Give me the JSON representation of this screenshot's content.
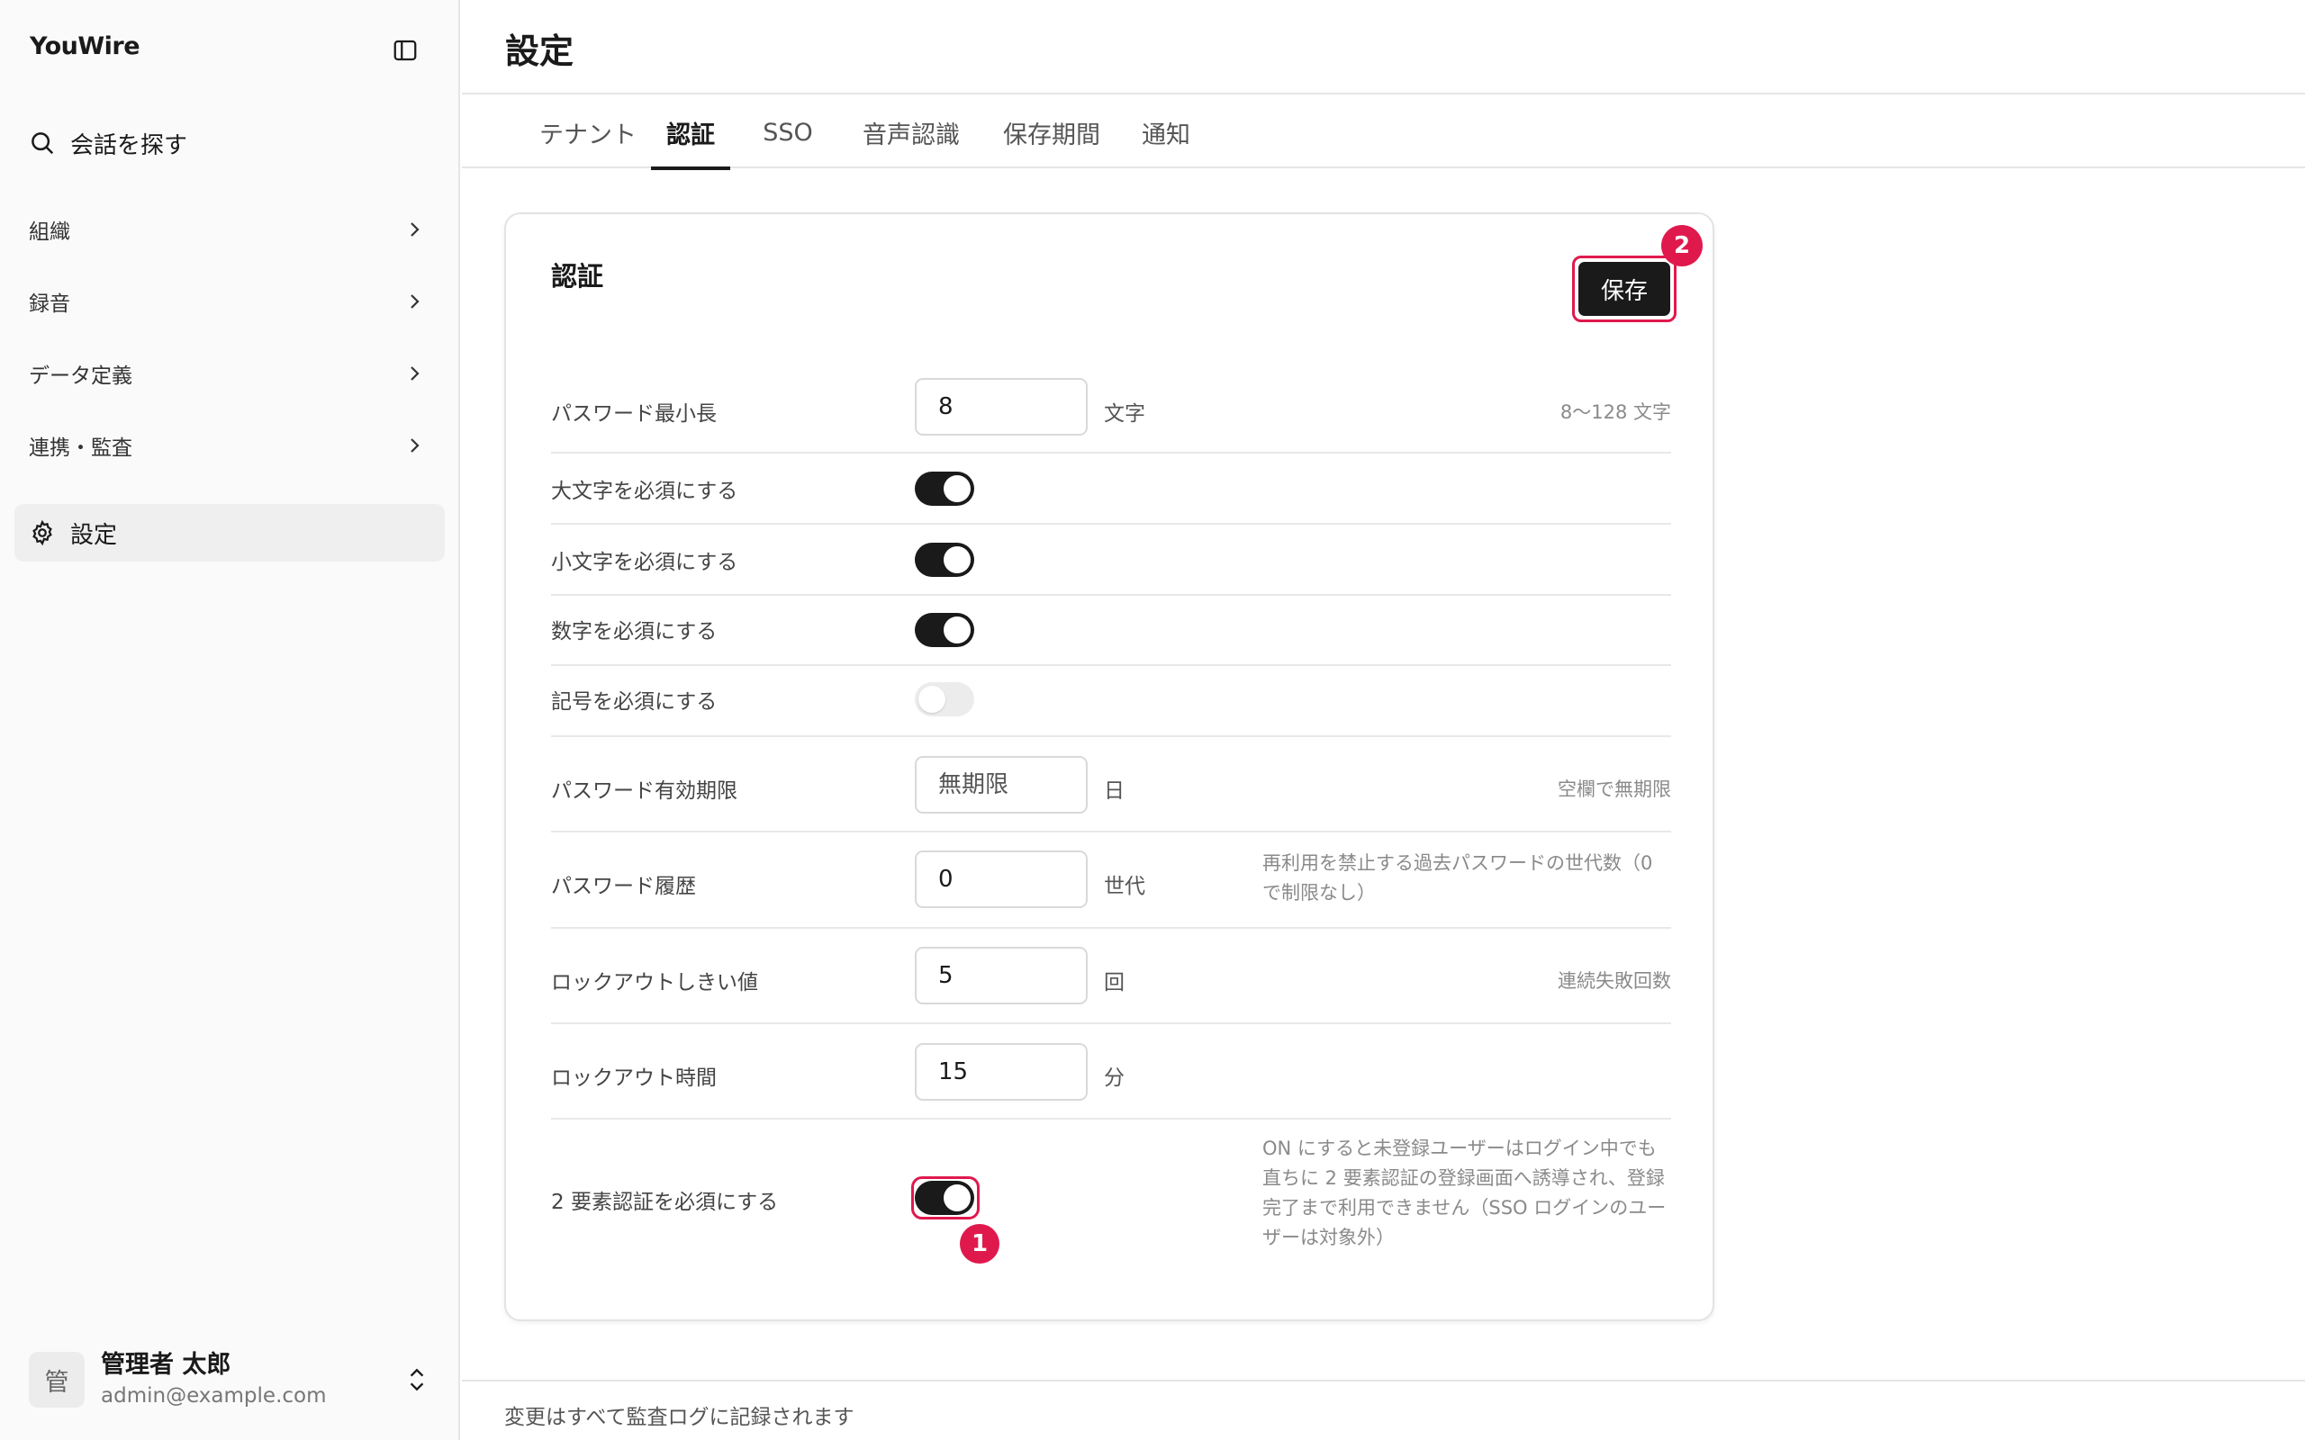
{
  "app": {
    "name": "YouWire"
  },
  "sidebar": {
    "search_label": "会話を探す",
    "items": [
      {
        "label": "組織"
      },
      {
        "label": "録音"
      },
      {
        "label": "データ定義"
      },
      {
        "label": "連携・監査"
      }
    ],
    "active_item": {
      "label": "設定"
    },
    "user": {
      "avatar_text": "管",
      "name": "管理者 太郎",
      "email": "admin@example.com"
    }
  },
  "header": {
    "title": "設定"
  },
  "tabs": [
    {
      "label": "テナント",
      "active": false
    },
    {
      "label": "認証",
      "active": true
    },
    {
      "label": "SSO",
      "active": false
    },
    {
      "label": "音声認識",
      "active": false
    },
    {
      "label": "保存期間",
      "active": false
    },
    {
      "label": "通知",
      "active": false
    }
  ],
  "card": {
    "title": "認証",
    "save_label": "保存",
    "markers": {
      "save": "2",
      "two_factor": "1"
    },
    "rows": {
      "min_length": {
        "label": "パスワード最小長",
        "value": "8",
        "unit": "文字",
        "hint": "8〜128 文字"
      },
      "uppercase": {
        "label": "大文字を必須にする",
        "on": true
      },
      "lowercase": {
        "label": "小文字を必須にする",
        "on": true
      },
      "digits": {
        "label": "数字を必須にする",
        "on": true
      },
      "symbols": {
        "label": "記号を必須にする",
        "on": false
      },
      "expiry": {
        "label": "パスワード有効期限",
        "value": "",
        "placeholder": "無期限",
        "unit": "日",
        "hint": "空欄で無期限"
      },
      "history": {
        "label": "パスワード履歴",
        "value": "0",
        "unit": "世代",
        "hint": "再利用を禁止する過去パスワードの世代数（0 で制限なし）"
      },
      "lockout_threshold": {
        "label": "ロックアウトしきい値",
        "value": "5",
        "unit": "回",
        "hint": "連続失敗回数"
      },
      "lockout_duration": {
        "label": "ロックアウト時間",
        "value": "15",
        "unit": "分"
      },
      "two_factor": {
        "label": "2 要素認証を必須にする",
        "on": true,
        "hint": "ON にすると未登録ユーザーはログイン中でも直ちに 2 要素認証の登録画面へ誘導され、登録完了まで利用できません（SSO ログインのユーザーは対象外）"
      }
    }
  },
  "footer": {
    "note": "変更はすべて監査ログに記録されます"
  },
  "colors": {
    "accent": "#1a1a1a",
    "highlight": "#e0194d"
  }
}
